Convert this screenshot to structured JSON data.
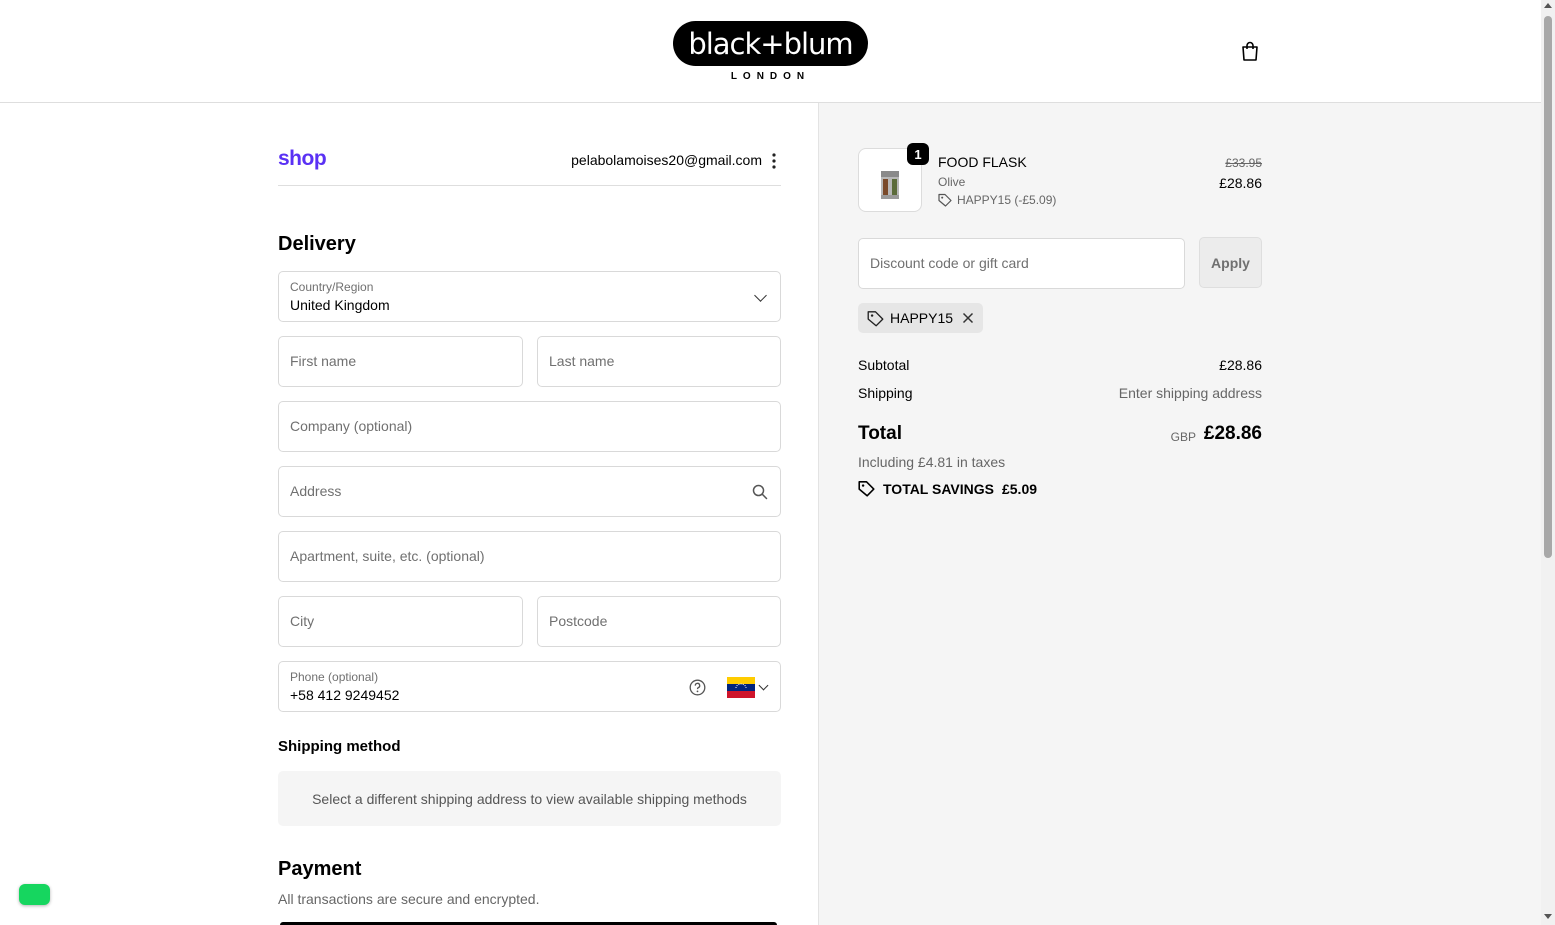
{
  "brand": {
    "name": "black+blum",
    "subtitle": "LONDON"
  },
  "account": {
    "shop_logo": "shop",
    "email": "pelabolamoises20@gmail.com"
  },
  "delivery": {
    "heading": "Delivery",
    "country": {
      "label": "Country/Region",
      "value": "United Kingdom"
    },
    "first_name": {
      "placeholder": "First name"
    },
    "last_name": {
      "placeholder": "Last name"
    },
    "company": {
      "placeholder": "Company (optional)"
    },
    "address": {
      "placeholder": "Address"
    },
    "apartment": {
      "placeholder": "Apartment, suite, etc. (optional)"
    },
    "city": {
      "placeholder": "City"
    },
    "postcode": {
      "placeholder": "Postcode"
    },
    "phone": {
      "label": "Phone (optional)",
      "value": "+58 412 9249452",
      "flag": "venezuela-flag"
    }
  },
  "shipping_method": {
    "heading": "Shipping method",
    "message": "Select a different shipping address to view available shipping methods"
  },
  "payment": {
    "heading": "Payment",
    "subtitle": "All transactions are secure and encrypted."
  },
  "order": {
    "item": {
      "quantity": "1",
      "name": "FOOD FLASK",
      "variant": "Olive",
      "discount": "HAPPY15 (-£5.09)",
      "original_price": "£33.95",
      "price": "£28.86"
    },
    "discount_input": {
      "placeholder": "Discount code or gift card"
    },
    "apply_label": "Apply",
    "applied_code": "HAPPY15",
    "subtotal_label": "Subtotal",
    "subtotal_value": "£28.86",
    "shipping_label": "Shipping",
    "shipping_value": "Enter shipping address",
    "total_label": "Total",
    "currency": "GBP",
    "total_value": "£28.86",
    "tax_note": "Including £4.81 in taxes",
    "savings_label": "TOTAL SAVINGS",
    "savings_value": "£5.09"
  },
  "colors": {
    "shop_purple": "#5a31f4",
    "chat_green": "#16d65f"
  }
}
